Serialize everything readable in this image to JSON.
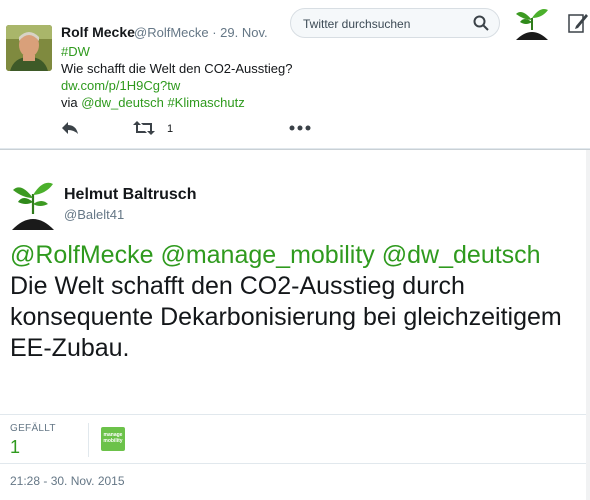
{
  "top_tweet": {
    "name": "Rolf Mecke",
    "handle_date": "@RolfMecke · 29. Nov.",
    "hashtag": "#DW",
    "text": "Wie schafft die Welt den CO2-Ausstieg?",
    "link": "dw.com/p/1H9Cg?tw",
    "via_prefix": "via ",
    "via_mention": "@dw_deutsch",
    "via_hashtag": "#Klimaschutz",
    "retweet_count": "1"
  },
  "search": {
    "placeholder": "Twitter durchsuchen"
  },
  "main_tweet": {
    "name": "Helmut Baltrusch",
    "handle": "@Balelt41",
    "mention_1": "@RolfMecke",
    "mention_2": "@manage_mobility",
    "mention_3": "@dw_deutsch",
    "body": "Die Welt schafft den CO2-Ausstieg durch konsequente Dekarbonisierung bei gleichzeitigem EE-Zubau.",
    "likes_label": "GEFÄLLT",
    "likes_count": "1",
    "liker_avatar_text": "manage mobility",
    "timestamp": "21:28 - 30. Nov. 2015"
  },
  "colors": {
    "accent_green": "#2f9a1e",
    "text": "#14171a",
    "muted": "#657786"
  },
  "icons": [
    "reply-icon",
    "retweet-icon",
    "more-icon",
    "search-icon",
    "plant-logo-icon",
    "compose-icon"
  ]
}
